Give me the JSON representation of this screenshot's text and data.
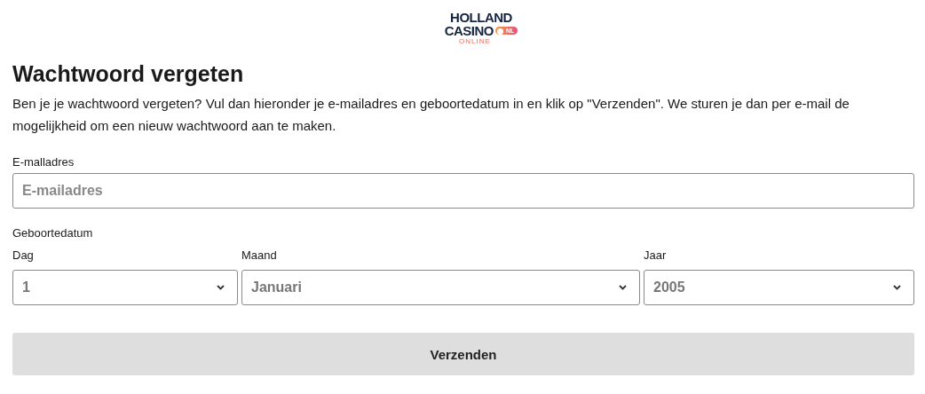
{
  "logo": {
    "line_1": "HOLLAND",
    "line_2": "CASINO",
    "badge": "NL",
    "line_3": "ONLINE"
  },
  "title": "Wachtwoord vergeten",
  "intro": "Ben je je wachtwoord vergeten? Vul dan hieronder je e-mailadres en geboortedatum in en klik op \"Verzenden\". We sturen je dan per e-mail de mogelijkheid om een nieuw wachtwoord aan te maken.",
  "email": {
    "label": "E-malladres",
    "placeholder": "E-mailadres"
  },
  "birthdate": {
    "label": "Geboortedatum",
    "selects": [
      {
        "label": "Dag",
        "value": "1"
      },
      {
        "label": "Maand",
        "value": "Januari"
      },
      {
        "label": "Jaar",
        "value": "2005"
      }
    ]
  },
  "submit": {
    "label": "Verzenden",
    "disabled": true
  }
}
